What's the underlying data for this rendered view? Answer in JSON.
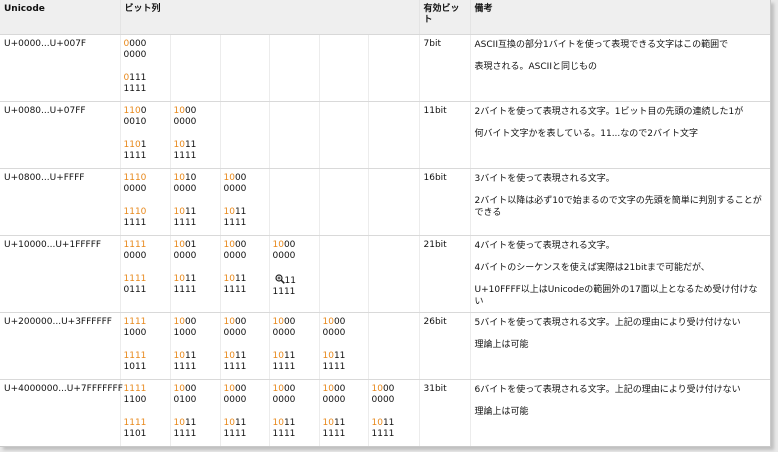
{
  "header": {
    "unicode": "Unicode",
    "bits": "ビット列",
    "effective": "有効ビット",
    "notes": "備考"
  },
  "rows": [
    {
      "range": "U+0000...U+007F",
      "bytes": [
        {
          "top": [
            "0",
            "000",
            "0000"
          ],
          "bottom": [
            "0",
            "111",
            "1111"
          ]
        }
      ],
      "effective": "7bit",
      "notes": [
        "ASCII互換の部分1バイトを使って表現できる文字はこの範囲で",
        "表現される。ASCIIと同じもの"
      ]
    },
    {
      "range": "U+0080...U+07FF",
      "bytes": [
        {
          "top": [
            "110",
            "0",
            "0010"
          ],
          "bottom": [
            "110",
            "1",
            "1111"
          ]
        },
        {
          "top": [
            "10",
            "00",
            "0000"
          ],
          "bottom": [
            "10",
            "11",
            "1111"
          ]
        }
      ],
      "effective": "11bit",
      "notes": [
        "2バイトを使って表現される文字。1ビット目の先頭の連続した1が",
        "何バイト文字かを表している。11...なので2バイト文字"
      ]
    },
    {
      "range": "U+0800...U+FFFF",
      "bytes": [
        {
          "top": [
            "1110",
            "",
            "0000"
          ],
          "bottom": [
            "1110",
            "",
            "1111"
          ]
        },
        {
          "top": [
            "10",
            "10",
            "0000"
          ],
          "bottom": [
            "10",
            "11",
            "1111"
          ]
        },
        {
          "top": [
            "10",
            "00",
            "0000"
          ],
          "bottom": [
            "10",
            "11",
            "1111"
          ]
        }
      ],
      "effective": "16bit",
      "notes": [
        "3バイトを使って表現される文字。",
        "2バイト以降は必ず10で始まるので文字の先頭を簡単に判別することができる"
      ]
    },
    {
      "range": "U+10000...U+1FFFFF",
      "bytes": [
        {
          "top": [
            "1111",
            "",
            "0000"
          ],
          "bottom": [
            "1111",
            "",
            "0111"
          ]
        },
        {
          "top": [
            "10",
            "01",
            "0000"
          ],
          "bottom": [
            "10",
            "11",
            "1111"
          ]
        },
        {
          "top": [
            "10",
            "00",
            "0000"
          ],
          "bottom": [
            "10",
            "11",
            "1111"
          ]
        },
        {
          "top": [
            "10",
            "00",
            "0000"
          ],
          "bottom": [
            "",
            "11",
            "1111"
          ]
        }
      ],
      "effective": "21bit",
      "notes": [
        "4バイトを使って表現される文字。",
        "4バイトのシーケンスを使えば実際は21bitまで可能だが、",
        "U+10FFFF以上はUnicodeの範囲外の17面以上となるため受け付けない"
      ]
    },
    {
      "range": "U+200000...U+3FFFFFF",
      "bytes": [
        {
          "top": [
            "1111",
            "",
            "1000"
          ],
          "bottom": [
            "1111",
            "",
            "1011"
          ]
        },
        {
          "top": [
            "10",
            "00",
            "1000"
          ],
          "bottom": [
            "10",
            "11",
            "1111"
          ]
        },
        {
          "top": [
            "10",
            "00",
            "0000"
          ],
          "bottom": [
            "10",
            "11",
            "1111"
          ]
        },
        {
          "top": [
            "10",
            "00",
            "0000"
          ],
          "bottom": [
            "10",
            "11",
            "1111"
          ]
        },
        {
          "top": [
            "10",
            "00",
            "0000"
          ],
          "bottom": [
            "10",
            "11",
            "1111"
          ]
        }
      ],
      "effective": "26bit",
      "notes": [
        "5バイトを使って表現される文字。上記の理由により受け付けない",
        "理論上は可能"
      ]
    },
    {
      "range": "U+4000000...U+7FFFFFFF",
      "bytes": [
        {
          "top": [
            "1111",
            "",
            "1100"
          ],
          "bottom": [
            "1111",
            "",
            "1101"
          ]
        },
        {
          "top": [
            "10",
            "00",
            "0100"
          ],
          "bottom": [
            "10",
            "11",
            "1111"
          ]
        },
        {
          "top": [
            "10",
            "00",
            "0000"
          ],
          "bottom": [
            "10",
            "11",
            "1111"
          ]
        },
        {
          "top": [
            "10",
            "00",
            "0000"
          ],
          "bottom": [
            "10",
            "11",
            "1111"
          ]
        },
        {
          "top": [
            "10",
            "00",
            "0000"
          ],
          "bottom": [
            "10",
            "11",
            "1111"
          ]
        },
        {
          "top": [
            "10",
            "00",
            "0000"
          ],
          "bottom": [
            "10",
            "11",
            "1111"
          ]
        }
      ],
      "effective": "31bit",
      "notes": [
        "6バイトを使って表現される文字。上記の理由により受け付けない",
        "理論上は可能"
      ]
    }
  ],
  "colors": {
    "prefix": "#e8891c",
    "header_bg": "#efefef"
  },
  "cursor_icon": "zoom-in-cursor-icon"
}
